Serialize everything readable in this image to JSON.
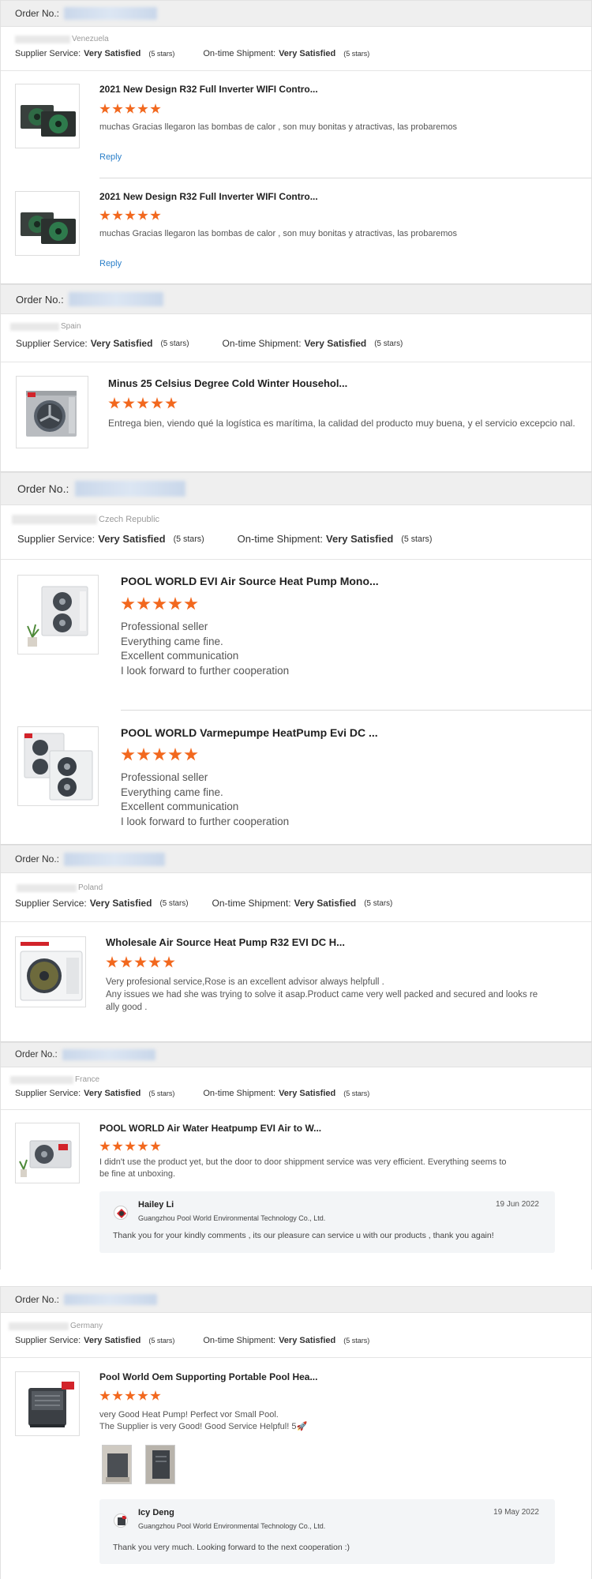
{
  "labels": {
    "order_no": "Order No.:",
    "supplier_service": "Supplier Service:",
    "ontime_shipment": "On-time Shipment:",
    "very_satisfied": "Very Satisfied",
    "five_stars": "(5 stars)",
    "reply": "Reply"
  },
  "colors": {
    "star": "#f2681e",
    "link": "#2a7fc9",
    "order_bar": "#efefef"
  },
  "rating_stars": 5,
  "reviews": [
    {
      "country": "Venezuela",
      "items": [
        {
          "title": "2021 New Design R32 Full Inverter WIFI Contro...",
          "text": "muchas Gracias llegaron las bombas de calor , son muy bonitas y atractivas, las probaremos",
          "reply_link": "Reply",
          "image": "dark-green-heat-pump-pair"
        },
        {
          "title": "2021 New Design R32 Full Inverter WIFI Contro...",
          "text": "muchas Gracias llegaron las bombas de calor , son muy bonitas y atractivas, las probaremos",
          "reply_link": "Reply",
          "image": "dark-green-heat-pump-pair"
        }
      ]
    },
    {
      "country": "Spain",
      "items": [
        {
          "title": "Minus 25 Celsius Degree Cold Winter Househol...",
          "text": "Entrega bien, viendo qué la logística es marítima, la calidad del producto muy buena, y el servicio excepcio nal.",
          "image": "grey-heat-pump"
        }
      ]
    },
    {
      "country": "Czech Republic",
      "items": [
        {
          "title": "POOL WORLD EVI Air Source Heat Pump Mono...",
          "lines": [
            "Professional seller",
            "Everything came fine.",
            "Excellent communication",
            "I look forward to further cooperation"
          ],
          "image": "white-twin-fan-heat-pump"
        },
        {
          "title": "POOL WORLD Varmepumpe HeatPump Evi DC ...",
          "lines": [
            "Professional seller",
            "Everything came fine.",
            "Excellent communication",
            "I look forward to further cooperation"
          ],
          "image": "white-twin-fan-heat-pump-pair"
        }
      ]
    },
    {
      "country": "Poland",
      "items": [
        {
          "title": "Wholesale Air Source Heat Pump R32 EVI DC H...",
          "lines": [
            "Very profesional service,Rose is an excellent advisor always helpfull .",
            "Any issues we had she was trying to solve it asap.Product came very well packed and secured and looks re",
            "ally good ."
          ],
          "image": "white-heat-pump-gold-fan"
        }
      ]
    },
    {
      "country": "France",
      "items": [
        {
          "title": "POOL WORLD Air Water Heatpump EVI Air to W...",
          "lines": [
            "I didn't use the product yet, but the door to door shippment service was very efficient. Everything seems to",
            "be fine at unboxing."
          ],
          "image": "small-heat-pump-with-plant",
          "supplier_reply": {
            "name": "Hailey Li",
            "company": "Guangzhou Pool World Environmental Technology Co., Ltd.",
            "date": "19 Jun 2022",
            "text": "Thank you for your kindly comments , its our pleasure can service u with our products , thank you again!"
          }
        }
      ]
    },
    {
      "country": "Germany",
      "items": [
        {
          "title": "Pool World Oem Supporting Portable Pool Hea...",
          "lines": [
            "very Good Heat Pump! Perfect vor Small Pool.",
            "The Supplier is very Good! Good Service Helpful! 5🚀"
          ],
          "image": "portable-pool-heater",
          "photos": [
            "customer-photo-1",
            "customer-photo-2"
          ],
          "supplier_reply": {
            "name": "Icy Deng",
            "company": "Guangzhou Pool World Environmental Technology Co., Ltd.",
            "date": "19 May 2022",
            "text": "Thank you very much. Looking forward to the next cooperation :)"
          }
        }
      ]
    }
  ]
}
